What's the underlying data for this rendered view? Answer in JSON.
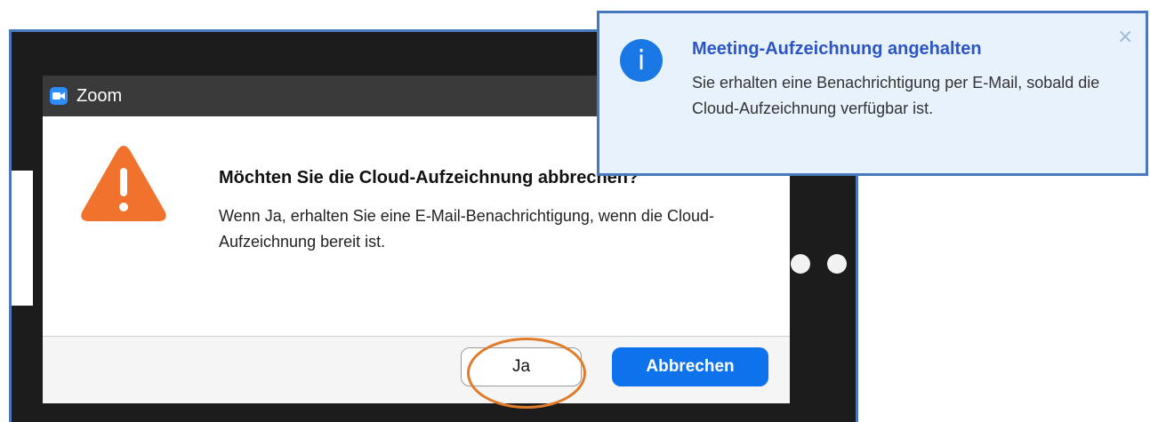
{
  "dialog": {
    "window_title": "Zoom",
    "heading": "Möchten Sie die Cloud-Aufzeichnung abbrechen?",
    "body": "Wenn Ja, erhalten Sie eine E-Mail-Benachrichtigung, wenn die Cloud-Aufzeichnung bereit ist.",
    "confirm_label": "Ja",
    "cancel_label": "Abbrechen"
  },
  "notification": {
    "title": "Meeting-Aufzeichnung angehalten",
    "body": "Sie erhalten eine Benachrichtigung per E-Mail, sobald die Cloud-Aufzeichnung verfügbar ist.",
    "info_glyph": "i",
    "close_glyph": "×"
  },
  "icons": {
    "warning": "warning-triangle-icon",
    "info": "info-icon",
    "close": "close-icon",
    "app": "zoom-logo-icon"
  },
  "colors": {
    "accent_blue": "#0e72ed",
    "warning_orange": "#f0722c",
    "highlight_orange": "#e07b2a",
    "toast_bg": "#e8f2fd",
    "toast_title": "#2b55c7"
  }
}
